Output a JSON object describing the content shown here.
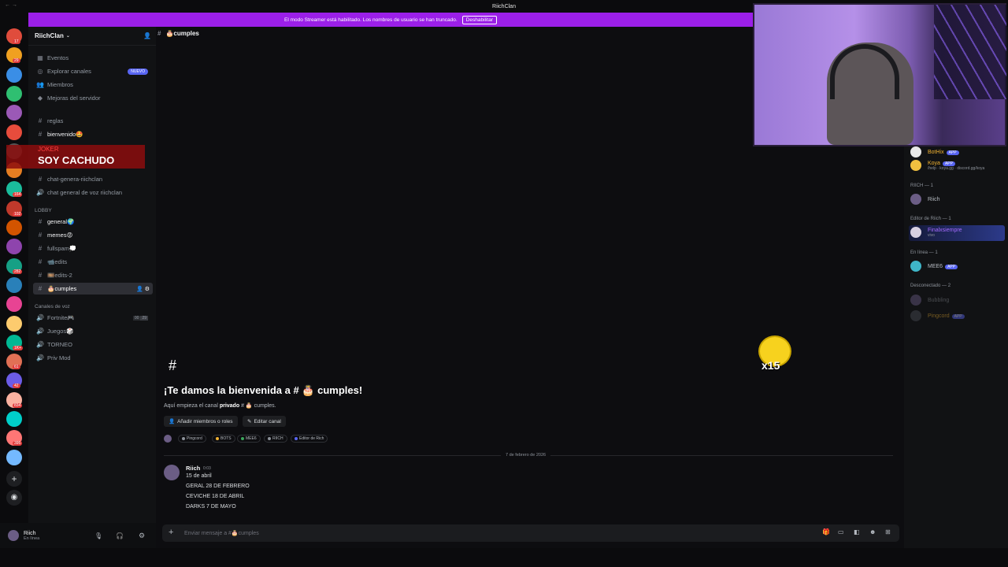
{
  "window": {
    "title": "RiichClan"
  },
  "streamer_bar": {
    "text": "El modo Streamer está habilitado. Los nombres de usuario se han truncado.",
    "button": "Deshabilitar"
  },
  "guild_badges": [
    "17",
    "29",
    "",
    "",
    "",
    "",
    "",
    "",
    "164",
    "102",
    "",
    "",
    "282",
    "",
    "",
    "",
    "1K+",
    "61",
    "42",
    "834",
    "",
    "395",
    "",
    "96",
    "463"
  ],
  "server": {
    "name": "RiichClan"
  },
  "sidebar": {
    "nav": [
      {
        "label": "Eventos",
        "icon": "calendar-icon"
      },
      {
        "label": "Explorar canales",
        "icon": "compass-icon",
        "pill": "NUEVO"
      },
      {
        "label": "Miembros",
        "icon": "members-icon"
      },
      {
        "label": "Mejoras del servidor",
        "icon": "boost-icon"
      }
    ],
    "channels_top": [
      {
        "label": "reglas"
      },
      {
        "label": "bienvenido🤩"
      }
    ],
    "overlay_name": "JOKER",
    "overlay_text": "SOY CACHUDO",
    "channels_mid": [
      {
        "label": "chat-genera-riichclan"
      },
      {
        "label": "chat general de voz riichclan"
      }
    ],
    "lobby_label": "LOBBY",
    "lobby": [
      {
        "label": "general🌍"
      },
      {
        "label": "memes😡"
      },
      {
        "label": "fullspam💭"
      },
      {
        "label": "📹edits"
      },
      {
        "label": "🎞️edits-2"
      },
      {
        "label": "🎂cumples"
      }
    ],
    "voice_label": "Canales de voz",
    "voice": [
      {
        "label": "Fortnite🎮",
        "count_a": "00",
        "count_b": "29"
      },
      {
        "label": "Juegos🎲"
      },
      {
        "label": "TORNEO"
      },
      {
        "label": "Priv Mod"
      }
    ]
  },
  "user": {
    "name": "Riich",
    "status": "En línea"
  },
  "channel": {
    "name": "🎂cumples",
    "welcome_title": "¡Te damos la bienvenida a # 🎂 cumples!",
    "welcome_sub_prefix": "Aquí empieza el canal ",
    "welcome_sub_bold": "privado",
    "welcome_sub_suffix": " # 🎂 cumples.",
    "add_members": "Añadir miembros o roles",
    "edit_channel": "Editar canal",
    "roles": [
      "Pingcord",
      "BOTS",
      "MEE6",
      "RIICH",
      "Editor de Rich"
    ]
  },
  "date_divider": "7 de febrero de 2026",
  "message": {
    "author": "Riich",
    "time": "0:03",
    "lines": [
      "15 de abril",
      "GERAL 28 DE FEBRERO",
      "CEVICHE 18 DE ABRIL",
      "DARKS 7 DE MAYO"
    ]
  },
  "composer": {
    "placeholder": "Enviar mensaje a #🎂cumples"
  },
  "members": {
    "bots": [
      {
        "name": "BotHix",
        "tag": "APP",
        "color": "#f0b232"
      },
      {
        "name": "Koya",
        "tag": "APP",
        "sub": "/help · koya.gg · discord.gg/koya",
        "color": "#f0b232"
      }
    ],
    "cat_riich": "RIICH — 1",
    "riich": [
      {
        "name": "Riich"
      }
    ],
    "cat_editor": "Editor de Riich — 1",
    "editor": [
      {
        "name": "Finalxsiempre",
        "sub": "vivo"
      }
    ],
    "cat_online": "En línea — 1",
    "online": [
      {
        "name": "MEE6",
        "tag": "APP"
      }
    ],
    "cat_offline": "Desconectado — 2",
    "offline": [
      {
        "name": "Bubbling"
      },
      {
        "name": "Pingcord",
        "tag": "APP"
      }
    ]
  },
  "sticker": {
    "label": "x15"
  }
}
